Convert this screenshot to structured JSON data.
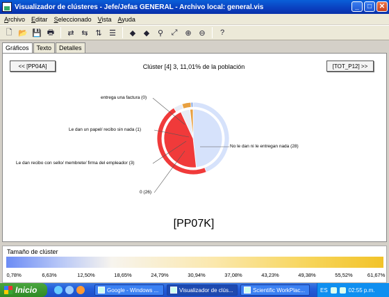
{
  "window": {
    "title": "Visualizador de clústeres - Jefe/Jefas GENERAL - Archivo local: general.vis"
  },
  "menu": [
    "Archivo",
    "Editar",
    "Seleccionado",
    "Vista",
    "Ayuda"
  ],
  "toolbar": [
    "new-icon",
    "open-icon",
    "save-icon",
    "print-icon",
    "swap-icon",
    "swap-back-icon",
    "sort-icon",
    "align-icon",
    "arrow-left-icon",
    "arrow-right-icon",
    "binoculars-icon",
    "zoom-fit-icon",
    "zoom-in-icon",
    "zoom-out-icon",
    "help-icon"
  ],
  "tabs": [
    "Gráficos",
    "Texto",
    "Detalles"
  ],
  "nav": {
    "prev": "<< [PP04A]",
    "next": "[TOT_P12] >>"
  },
  "cluster": {
    "title": "Clúster [4] 3, 11,01% de la población",
    "code": "[PP07K]"
  },
  "pie_labels": [
    "entrega una factura (0)",
    "Le dan un papel/ recibo sin nada (1)",
    "Le dan recibo con sello/ membrete/ firma del empleador (3)",
    "0 (26)",
    "No le dan ni le entregan nada (28)"
  ],
  "chart_data": {
    "type": "pie",
    "inner_values": [
      {
        "label": "No le dan ni le entregan nada (28)",
        "value": 28,
        "color": "#d6e2fb"
      },
      {
        "label": "0 (26)",
        "value": 26,
        "color": "#f03a3a"
      },
      {
        "label": "Le dan recibo con sello/ membrete/ firma del empleador (3)",
        "value": 3,
        "color": "#e8ecf5"
      },
      {
        "label": "Le dan un papel/ recibo sin nada (1)",
        "value": 1,
        "color": "#e8a040"
      }
    ],
    "outer_values": [
      {
        "label": "No le dan ni le entregan nada",
        "value": 44,
        "color": "#d6e2fb"
      },
      {
        "label": "0",
        "value": 47,
        "color": "#f03a3a"
      },
      {
        "label": "Le dan recibo con sello/ membrete/ firma del empleador",
        "value": 4,
        "color": "#e8ecf5"
      },
      {
        "label": "Le dan un papel/ recibo sin nada",
        "value": 4,
        "color": "#e8a040"
      },
      {
        "label": "entrega una factura",
        "value": 1,
        "color": "#8fb0e8"
      }
    ]
  },
  "legend": {
    "title": "Tamaño de clúster",
    "ticks": [
      "0,78%",
      "6,63%",
      "12,50%",
      "18,65%",
      "24,79%",
      "30,94%",
      "37,08%",
      "43,23%",
      "49,38%",
      "55,52%",
      "61,67%"
    ]
  },
  "taskbar": {
    "start": "Inicio",
    "tasks": [
      "Google - Windows ...",
      "Visualizador de clús...",
      "Scientific WorkPlac..."
    ],
    "lang": "ES",
    "clock": "02:55 p.m."
  }
}
